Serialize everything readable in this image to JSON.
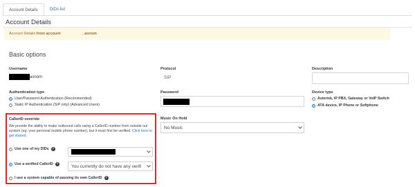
{
  "tabs": [
    {
      "label": "Account Details",
      "active": true
    },
    {
      "label": "DIDs list",
      "active": false
    }
  ],
  "page_title": "Account Details",
  "banner": {
    "prefix": "Account Details",
    "from_text": " from account",
    "account_suffix": "_asnom"
  },
  "section_title": "Basic options",
  "username": {
    "label": "Username",
    "value_suffix": "asnom"
  },
  "protocol": {
    "label": "Protocol",
    "value": "SIP"
  },
  "description": {
    "label": "Description"
  },
  "auth": {
    "label": "Authentication type",
    "options": [
      {
        "label": "User/Password Authentication (Recommended)",
        "checked": true
      },
      {
        "label": "Static IP Authentication (SIP only) (Advanced Users)",
        "checked": false
      }
    ]
  },
  "password": {
    "label": "Password"
  },
  "device": {
    "label": "Device type",
    "options": [
      {
        "label": "Asterisk, IP PBX, Gateway or VoIP Switch",
        "checked": false
      },
      {
        "label": "ATA device, IP Phone or Softphone",
        "checked": true
      }
    ]
  },
  "callerid": {
    "label": "CallerID override",
    "description": "We provide the ability to make outbound calls using a CallerID number from outside our system (eg. your personal mobile phone number), but it must first be verified.",
    "link_text": "Click here to get started.",
    "options": [
      {
        "label": "Use one of my DIDs",
        "checked": false
      },
      {
        "label": "Use a verified CallerID",
        "checked": true
      },
      {
        "label": "I use a system capable of passing its own CallerID",
        "checked": false
      }
    ],
    "verified_select_value": "You currently do not have any verifi"
  },
  "moh": {
    "label": "Music On Hold",
    "value": "No Music"
  },
  "colors": {
    "accent": "#1a73e8",
    "highlight": "#e3242b",
    "banner_bg": "#fcf8e3"
  }
}
